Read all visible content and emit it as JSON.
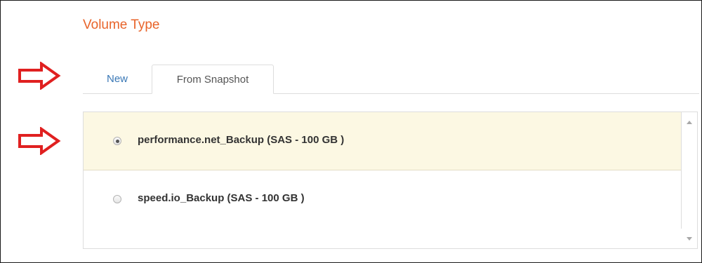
{
  "section": {
    "title": "Volume Type"
  },
  "tabs": [
    {
      "label": "New",
      "active": false
    },
    {
      "label": "From Snapshot",
      "active": true
    }
  ],
  "snapshots": [
    {
      "label": "performance.net_Backup (SAS - 100 GB )",
      "selected": true
    },
    {
      "label": "speed.io_Backup (SAS - 100 GB )",
      "selected": false
    }
  ],
  "annotations": {
    "arrow_color": "#e02020",
    "arrow_icon": "right-arrow-outline-icon"
  },
  "colors": {
    "title": "#e8642a",
    "link": "#3a78b6",
    "selected_row": "#fcf8e3"
  }
}
